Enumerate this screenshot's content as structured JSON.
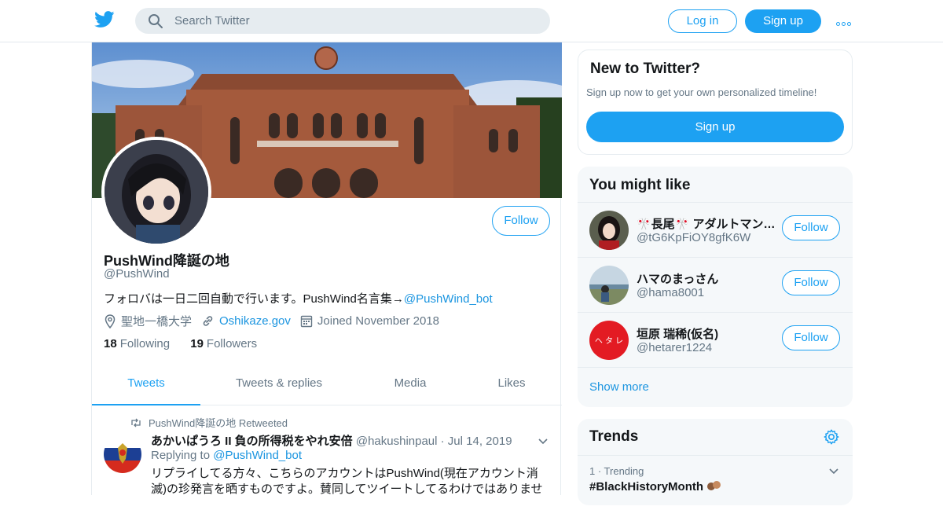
{
  "nav": {
    "search_placeholder": "Search Twitter",
    "login_label": "Log in",
    "signup_label": "Sign up"
  },
  "profile": {
    "name": "PushWind降誕の地",
    "handle": "@PushWind",
    "follow_label": "Follow",
    "bio_text": "フォロバは一日二回自動で行います。PushWind名言集→",
    "bio_link": "@PushWind_bot",
    "location": "聖地一橋大学",
    "website": "Oshikaze.gov",
    "joined": "Joined November 2018",
    "following_count": "18",
    "following_label": "Following",
    "followers_count": "19",
    "followers_label": "Followers"
  },
  "tabs": [
    "Tweets",
    "Tweets & replies",
    "Media",
    "Likes"
  ],
  "tweet": {
    "retweet_text": "PushWind降誕の地 Retweeted",
    "author": "あかいぱうろ II 負の所得税をやれ安倍",
    "handle_date": "@hakushinpaul · Jul 14, 2019",
    "replying_prefix": "Replying to",
    "replying_to": "@PushWind_bot",
    "text": "リプライしてる方々、こちらのアカウントはPushWind(現在アカウント消滅)の珍発言を晒すものですよ。賛同してツイートしてるわけではありませ"
  },
  "sidebar": {
    "new_title": "New to Twitter?",
    "new_sub": "Sign up now to get your own personalized timeline!",
    "new_button": "Sign up",
    "like_title": "You might like",
    "users": [
      {
        "name": "🎌長尾🎌 アダルトマン…",
        "handle": "@tG6KpFiOY8gfK6W",
        "follow": "Follow"
      },
      {
        "name": "ハマのまっさん",
        "handle": "@hama8001",
        "follow": "Follow"
      },
      {
        "name": "垣原 瑞稀(仮名)",
        "handle": "@hetarer1224",
        "follow": "Follow"
      }
    ],
    "show_more": "Show more",
    "trends_title": "Trends",
    "trend_meta": "1 · Trending",
    "trend_tag": "#BlackHistoryMonth"
  },
  "colors": {
    "accent": "#1da1f2",
    "link": "#1b95e0",
    "muted": "#657786"
  },
  "icons": [
    "twitter-bird-icon",
    "search-icon",
    "more-dots-icon",
    "location-icon",
    "link-icon",
    "calendar-icon",
    "retweet-icon",
    "chevron-down-icon",
    "gear-icon"
  ]
}
